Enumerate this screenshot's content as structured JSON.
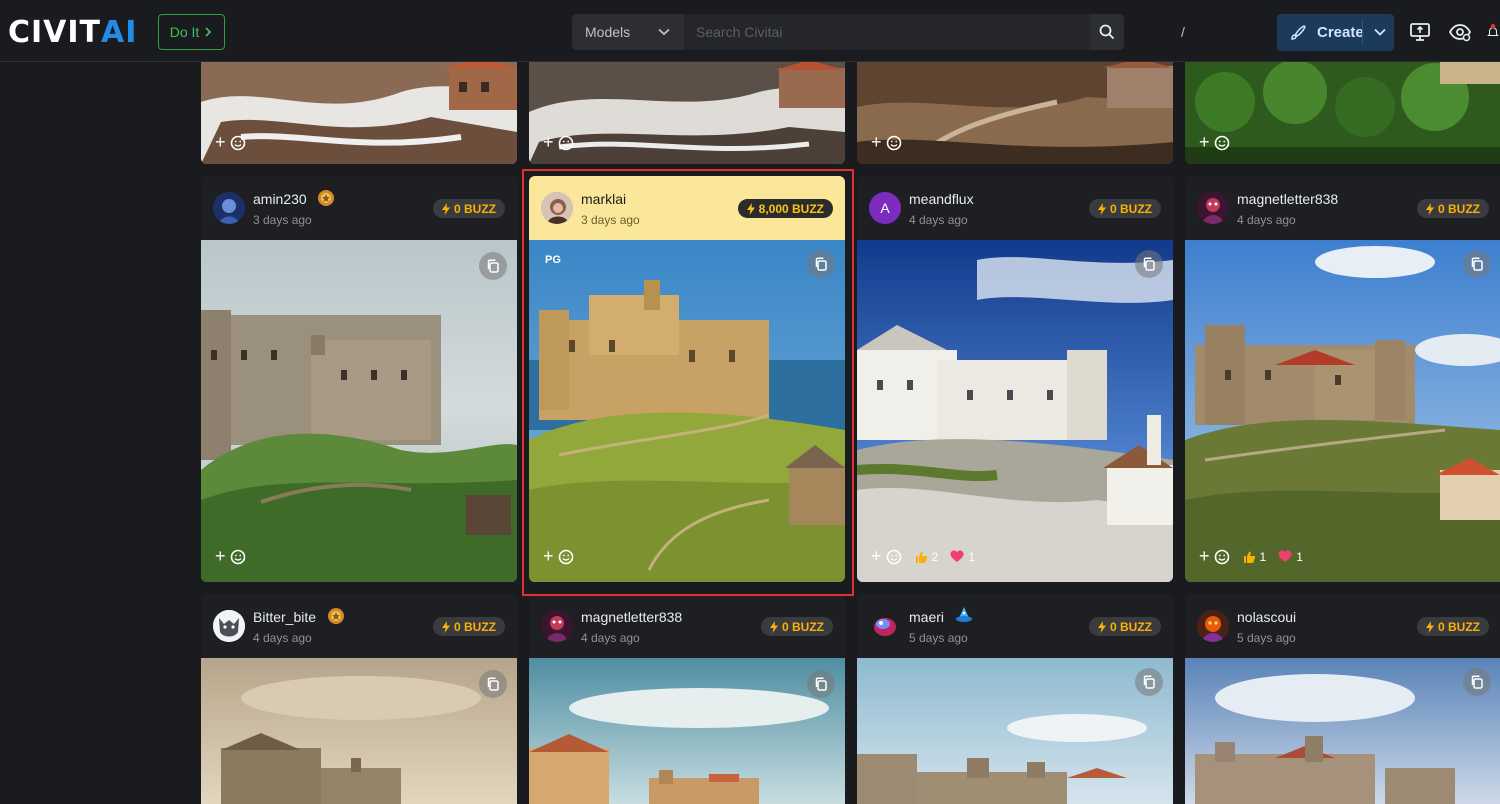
{
  "header": {
    "logo_part1": "CIVIT",
    "logo_part2": "AI",
    "doit_label": "Do It",
    "search_type": "Models",
    "search_placeholder": "Search Civitai",
    "search_shortcut": "/",
    "create_label": "Create"
  },
  "top_row": [
    {
      "reaction_add": "+"
    },
    {
      "reaction_add": "+"
    },
    {
      "reaction_add": "+"
    },
    {
      "reaction_add": "+"
    }
  ],
  "row1": [
    {
      "username": "amin230",
      "time": "3 days ago",
      "buzz": "0 BUZZ",
      "reactions": []
    },
    {
      "username": "marklai",
      "time": "3 days ago",
      "buzz": "8,000 BUZZ",
      "rating": "PG",
      "reactions": []
    },
    {
      "username": "meandflux",
      "avatar_letter": "A",
      "time": "4 days ago",
      "buzz": "0 BUZZ",
      "likes": "2",
      "hearts": "1"
    },
    {
      "username": "magnetletter838",
      "time": "4 days ago",
      "buzz": "0 BUZZ",
      "likes": "1",
      "hearts": "1"
    }
  ],
  "row2": [
    {
      "username": "Bitter_bite",
      "time": "4 days ago",
      "buzz": "0 BUZZ"
    },
    {
      "username": "magnetletter838",
      "time": "4 days ago",
      "buzz": "0 BUZZ"
    },
    {
      "username": "maeri",
      "time": "5 days ago",
      "buzz": "0 BUZZ"
    },
    {
      "username": "nolascoui",
      "time": "5 days ago",
      "buzz": "0 BUZZ"
    }
  ],
  "colors": {
    "background": "#1a1b1e",
    "card": "#25262b",
    "highlight": "#fbe79a",
    "buzz": "#fab005",
    "accent": "#228be6",
    "doit": "#40c057",
    "frame": "#e03131"
  }
}
